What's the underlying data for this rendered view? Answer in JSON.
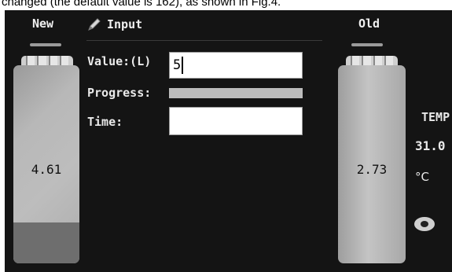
{
  "caption": "changed (the default value is 162), as shown in Fig.4.",
  "header": {
    "new_label": "New",
    "input_label": "Input",
    "old_label": "Old"
  },
  "icons": {
    "input": "pencil-icon",
    "view": "eye-icon"
  },
  "tank_new": {
    "value": "4.61"
  },
  "tank_old": {
    "value": "2.73"
  },
  "form": {
    "value_label": "Value:(L)",
    "value_input": "5",
    "progress_label": "Progress:",
    "progress": 0,
    "time_label": "Time:",
    "time_value": ""
  },
  "temp": {
    "label": "TEMP",
    "value": "31.0",
    "unit": "°C"
  }
}
